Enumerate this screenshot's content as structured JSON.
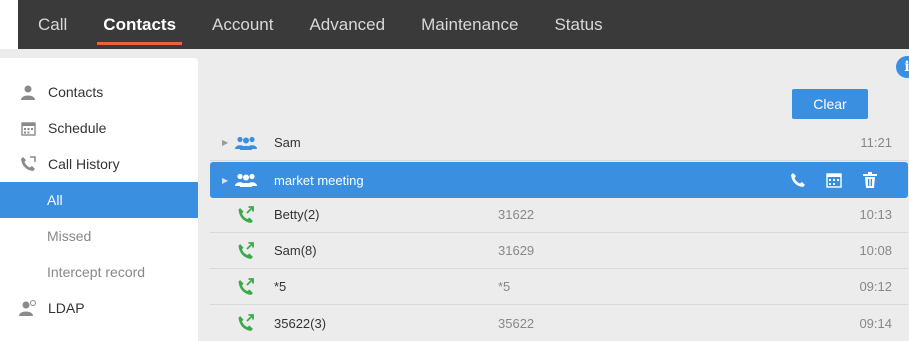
{
  "nav": {
    "items": [
      {
        "label": "Call"
      },
      {
        "label": "Contacts"
      },
      {
        "label": "Account"
      },
      {
        "label": "Advanced"
      },
      {
        "label": "Maintenance"
      },
      {
        "label": "Status"
      }
    ],
    "active": "Contacts"
  },
  "sidebar": {
    "contacts": "Contacts",
    "schedule": "Schedule",
    "call_history": "Call History",
    "sub": {
      "all": "All",
      "missed": "Missed",
      "intercept": "Intercept record"
    },
    "ldap": "LDAP"
  },
  "toolbar": {
    "clear_label": "Clear",
    "info_label": "i"
  },
  "rows": [
    {
      "name": "Sam",
      "number": "",
      "time": "11:21",
      "type": "group-icon"
    },
    {
      "name": "market meeting",
      "number": "",
      "time": "",
      "type": "group-icon",
      "selected": true
    },
    {
      "name": "Betty(2)",
      "number": "31622",
      "time": "10:13",
      "type": "outgoing-call-icon"
    },
    {
      "name": "Sam(8)",
      "number": "31629",
      "time": "10:08",
      "type": "outgoing-call-icon"
    },
    {
      "name": "*5",
      "number": "*5",
      "time": "09:12",
      "type": "outgoing-call-icon"
    },
    {
      "name": "35622(3)",
      "number": "35622",
      "time": "09:14",
      "type": "outgoing-call-icon"
    }
  ],
  "colors": {
    "accent": "#3a8fe0",
    "nav_bg": "#3a3a3a",
    "active_underline": "#e8643a",
    "call_green": "#3aaa4a"
  }
}
